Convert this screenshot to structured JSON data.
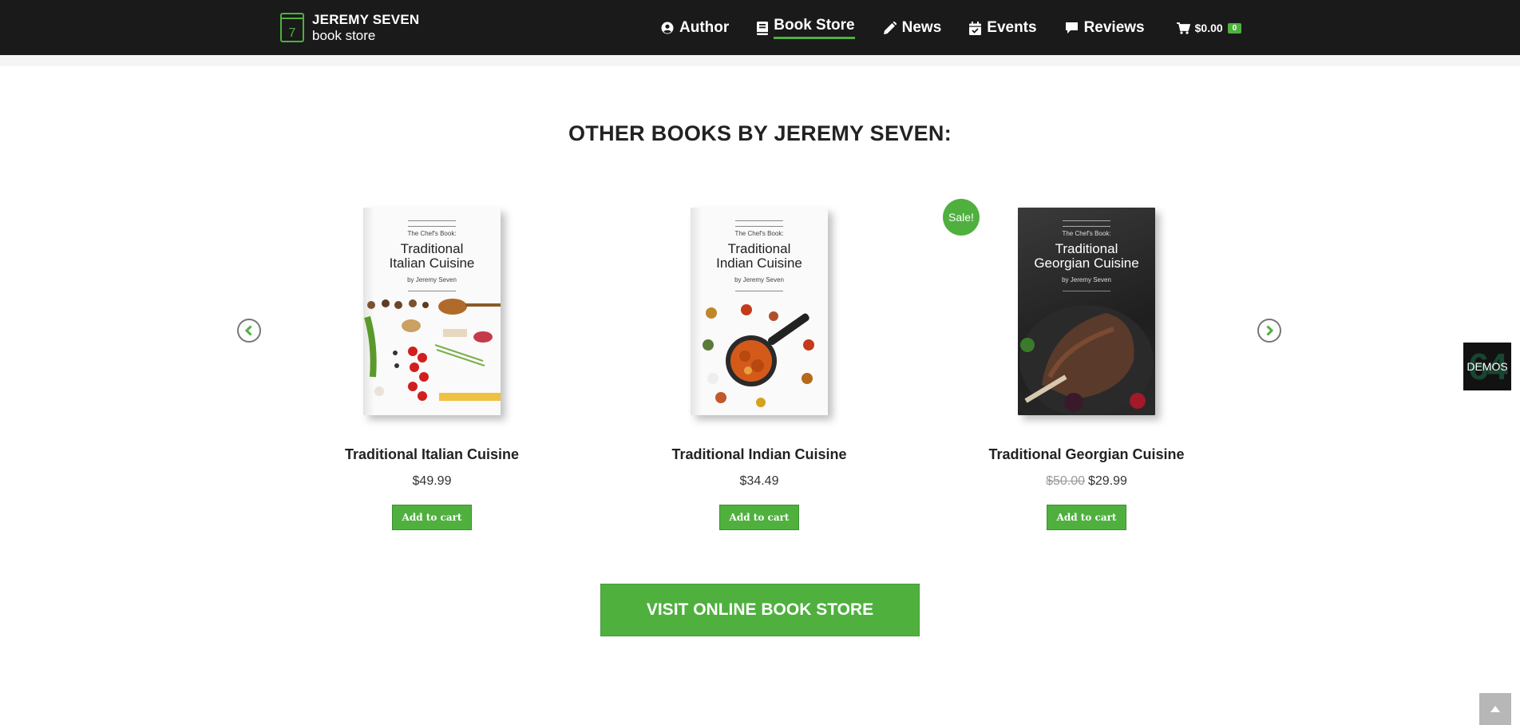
{
  "header": {
    "logo": {
      "digit": "7",
      "title": "JEREMY SEVEN",
      "subtitle": "book store"
    },
    "nav": [
      {
        "label": "Author",
        "icon": "user-circle-icon"
      },
      {
        "label": "Book Store",
        "icon": "book-icon",
        "active": true
      },
      {
        "label": "News",
        "icon": "pencil-icon"
      },
      {
        "label": "Events",
        "icon": "calendar-check-icon"
      },
      {
        "label": "Reviews",
        "icon": "comment-icon"
      }
    ],
    "cart": {
      "total": "$0.00",
      "count": "0",
      "icon": "cart-icon"
    }
  },
  "section": {
    "title": "OTHER BOOKS BY JEREMY SEVEN:"
  },
  "products": [
    {
      "cover_series": "The Chef's Book:",
      "cover_title_1": "Traditional",
      "cover_title_2": "Italian Cuisine",
      "cover_author": "by Jeremy Seven",
      "title": "Traditional Italian Cuisine",
      "price": "$49.99",
      "button": "Add to cart"
    },
    {
      "cover_series": "The Chef's Book:",
      "cover_title_1": "Traditional",
      "cover_title_2": "Indian Cuisine",
      "cover_author": "by Jeremy Seven",
      "title": "Traditional Indian Cuisine",
      "price": "$34.49",
      "button": "Add to cart"
    },
    {
      "cover_series": "The Chef's Book:",
      "cover_title_1": "Traditional",
      "cover_title_2": "Georgian Cuisine",
      "cover_author": "by Jeremy Seven",
      "title": "Traditional Georgian Cuisine",
      "old_price": "$50.00",
      "price": "$29.99",
      "button": "Add to cart",
      "badge": "Sale!"
    }
  ],
  "carousel": {
    "prev_icon": "chevron-left-icon",
    "next_icon": "chevron-right-icon"
  },
  "cta": {
    "label": "VISIT ONLINE BOOK STORE"
  },
  "demos": {
    "label": "DEMOS",
    "bg_number": "64"
  },
  "colors": {
    "accent": "#4fb03e",
    "header_bg": "#1a1a1a"
  }
}
